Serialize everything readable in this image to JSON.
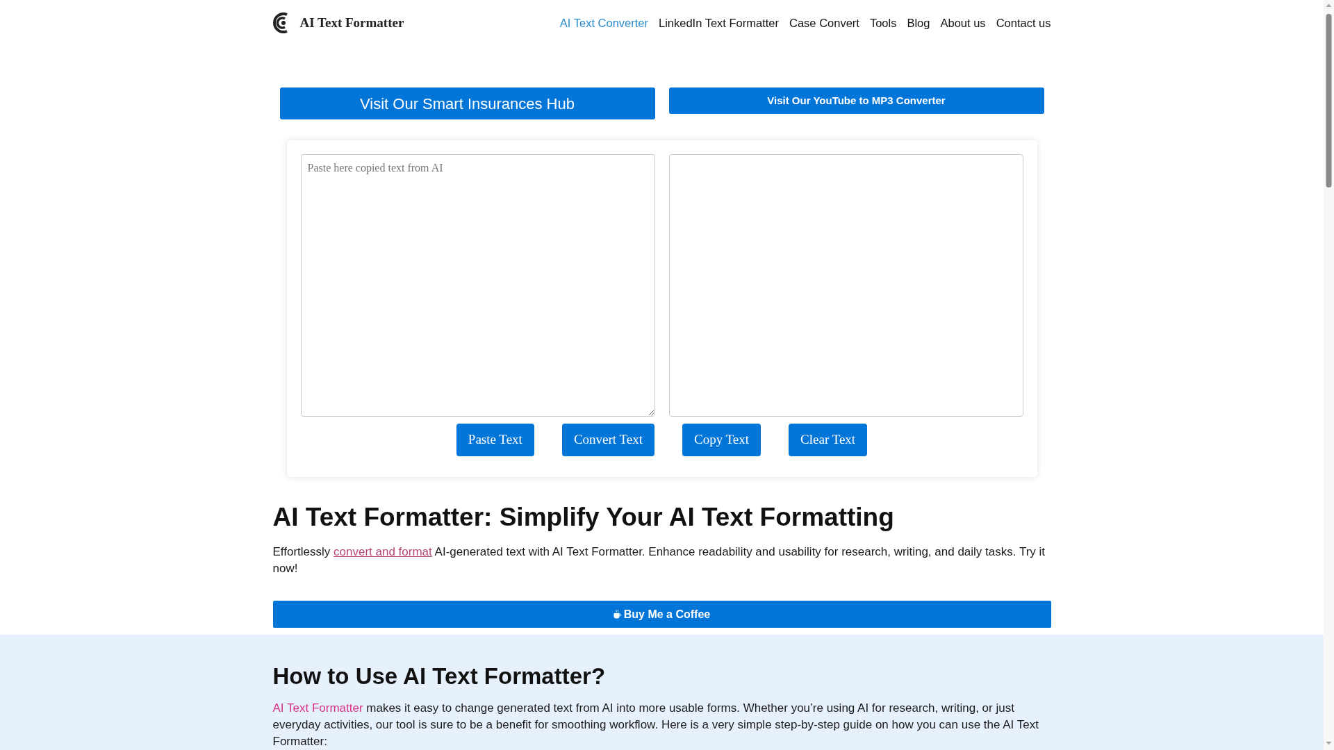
{
  "header": {
    "logo_text": "AI Text Formatter",
    "nav": [
      {
        "label": "AI Text Converter",
        "selected": true
      },
      {
        "label": "LinkedIn Text Formatter",
        "selected": false
      },
      {
        "label": "Case Convert",
        "selected": false
      },
      {
        "label": "Tools",
        "selected": false
      },
      {
        "label": "Blog",
        "selected": false
      },
      {
        "label": "About us",
        "selected": false
      },
      {
        "label": "Contact us",
        "selected": false
      }
    ]
  },
  "promo_buttons": [
    {
      "label": "Visit Our Smart Insurances Hub",
      "kind": "large"
    },
    {
      "label": "Visit Our YouTube to MP3 Converter",
      "kind": "small"
    }
  ],
  "tool": {
    "input": {
      "placeholder": "Paste here copied text from AI"
    },
    "buttons": [
      "Paste Text",
      "Convert Text",
      "Copy Text",
      "Clear Text"
    ]
  },
  "intro": {
    "title": "AI Text Formatter: Simplify Your AI Text Formatting",
    "paragraph": [
      {
        "kind": "text",
        "text": "Effortlessly "
      },
      {
        "kind": "link",
        "text": "convert and format"
      },
      {
        "kind": "text",
        "text": " AI-generated text with AI Text Formatter. Enhance readability and usability for research, writing, and daily tasks. Try it now!"
      }
    ],
    "coffee_button": "Buy Me a Coffee"
  },
  "how_to": {
    "title": "How to Use AI Text Formatter?",
    "paragraph": [
      {
        "kind": "link",
        "text": "AI Text Formatter"
      },
      {
        "kind": "text",
        "text": " makes it easy to change generated text from AI into more usable forms. Whether you’re using AI for research, writing, or just everyday activities, our tool is sure to be a benefit for smoothing workflow. Here is a very simple step-by-step guide on how you can use the AI Text Formatter:"
      }
    ]
  }
}
